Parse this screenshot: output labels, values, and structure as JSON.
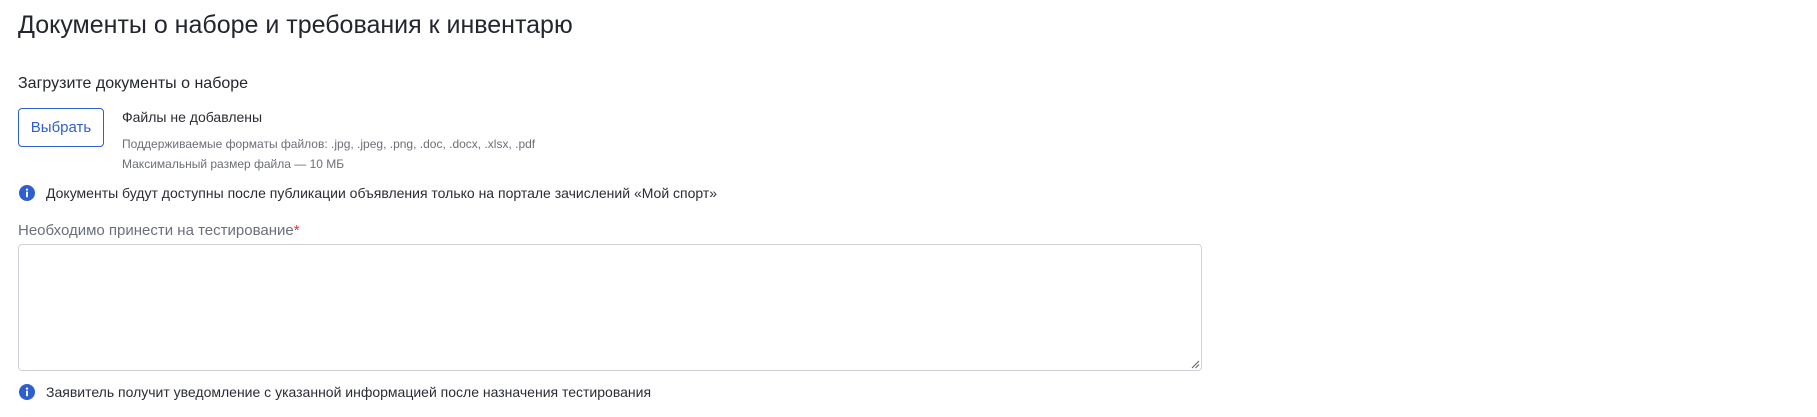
{
  "section": {
    "title": "Документы о наборе и требования к инвентарю"
  },
  "upload": {
    "label": "Загрузите документы о наборе",
    "choose_button": "Выбрать",
    "files_status": "Файлы не добавлены",
    "formats_hint": "Поддерживаемые форматы файлов: .jpg, .jpeg, .png, .doc, .docx, .xlsx, .pdf",
    "size_hint": "Максимальный размер файла — 10 МБ",
    "info_text": "Документы будут доступны после публикации объявления только на портале зачислений «Мой спорт»",
    "info_icon": "info-icon"
  },
  "testing_field": {
    "label": "Необходимо принести на тестирование",
    "required_mark": "*",
    "value": "",
    "info_text": "Заявитель получит уведомление с указанной информацией после назначения тестирования",
    "info_icon": "info-icon"
  },
  "colors": {
    "accent": "#2f5fce",
    "required": "#e5322d",
    "hint_text": "#6b6f7a",
    "border": "#cfd2d8"
  }
}
